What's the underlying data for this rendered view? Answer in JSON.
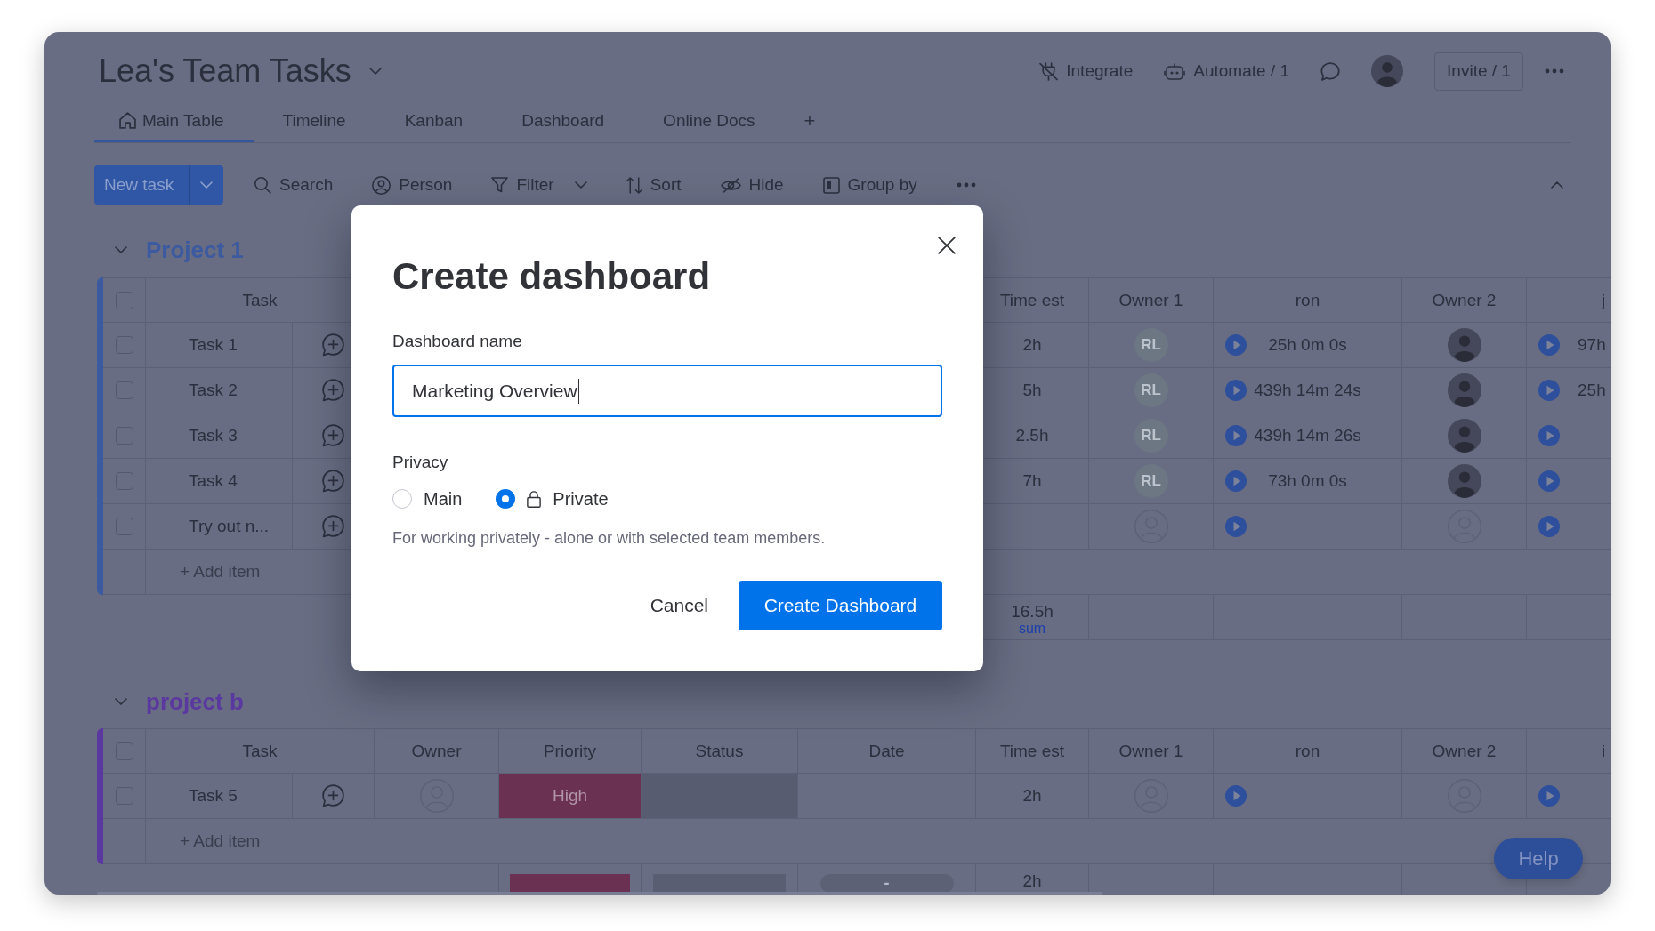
{
  "board": {
    "title": "Lea's Team Tasks"
  },
  "header_actions": [
    {
      "kind": "integrate",
      "label": "Integrate"
    },
    {
      "kind": "automate",
      "label": "Automate / 1"
    },
    {
      "kind": "updates"
    },
    {
      "kind": "account"
    },
    {
      "kind": "invite",
      "label": "Invite / 1"
    },
    {
      "kind": "more"
    }
  ],
  "views": [
    {
      "kind": "main",
      "label": "Main Table",
      "selected": true
    },
    {
      "kind": "view",
      "label": "Timeline",
      "selected": false
    },
    {
      "kind": "view",
      "label": "Kanban",
      "selected": false
    },
    {
      "kind": "view",
      "label": "Dashboard",
      "selected": false
    },
    {
      "kind": "view",
      "label": "Online Docs",
      "selected": false
    }
  ],
  "add_view": "+",
  "toolbar": {
    "new_task": "New task",
    "items": [
      {
        "kind": "search",
        "label": "Search"
      },
      {
        "kind": "person",
        "label": "Person"
      },
      {
        "kind": "filter",
        "label": "Filter",
        "dropdown": true
      },
      {
        "kind": "sort",
        "label": "Sort"
      },
      {
        "kind": "hide",
        "label": "Hide"
      },
      {
        "kind": "group",
        "label": "Group by"
      },
      {
        "kind": "more"
      }
    ]
  },
  "groups": [
    {
      "title": "Project 1",
      "color": "#3c5aa0",
      "expanded": true,
      "all_checked": false,
      "columns": {
        "task": "Task",
        "time_est": "Time est",
        "owner_1": "Owner 1",
        "ron": "ron",
        "owner_2": "Owner 2",
        "column_10": "j"
      },
      "rows": [
        {
          "task": "Task 1",
          "checked": false,
          "time_est": "2h",
          "owner_1": {
            "kind": "initials",
            "initials": "RL"
          },
          "ron": "25h 0m 0s",
          "owner_2": {
            "kind": "photo"
          },
          "column_10": "97h"
        },
        {
          "task": "Task 2",
          "checked": false,
          "time_est": "5h",
          "owner_1": {
            "kind": "initials",
            "initials": "RL"
          },
          "ron": "439h 14m 24s",
          "owner_2": {
            "kind": "photo"
          },
          "column_10": "25h"
        },
        {
          "task": "Task 3",
          "checked": false,
          "time_est": "2.5h",
          "owner_1": {
            "kind": "initials",
            "initials": "RL"
          },
          "ron": "439h 14m 26s",
          "owner_2": {
            "kind": "photo"
          }
        },
        {
          "task": "Task 4",
          "checked": false,
          "time_est": "7h",
          "owner_1": {
            "kind": "initials",
            "initials": "RL"
          },
          "ron": "73h 0m 0s",
          "owner_2": {
            "kind": "photo"
          }
        },
        {
          "task": "Try out n...",
          "checked": false,
          "owner_1": {
            "kind": "empty"
          },
          "owner_2": {
            "kind": "empty"
          }
        }
      ],
      "add_item": "+ Add item",
      "summary": {
        "time_est": "16.5h",
        "time_est_caption": "sum"
      }
    },
    {
      "title": "project b",
      "color": "#5a389f",
      "expanded": true,
      "all_checked": false,
      "columns": {
        "task": "Task",
        "owner": "Owner",
        "priority": "Priority",
        "status": "Status",
        "date": "Date",
        "time_est": "Time est",
        "owner_1": "Owner 1",
        "ron": "ron",
        "owner_2": "Owner 2",
        "column_10": "i"
      },
      "rows": [
        {
          "task": "Task 5",
          "checked": false,
          "owner": {
            "kind": "empty"
          },
          "priority": {
            "label": "High",
            "color": "#6b3152"
          },
          "status": {
            "color": "#585c70"
          },
          "time_est": "2h",
          "owner_1": {
            "kind": "empty"
          },
          "owner_2": {
            "kind": "empty"
          }
        }
      ],
      "add_item": "+ Add item",
      "summary": {
        "priority": [
          {
            "color": "#6b3152"
          }
        ],
        "status": [
          {
            "color": "#5a5e72"
          }
        ],
        "date": "-",
        "time_est": "2h"
      }
    }
  ],
  "help": "Help",
  "dialog": {
    "title": "Create dashboard",
    "name_label": "Dashboard name",
    "name_value": "Marketing Overview",
    "privacy_label": "Privacy",
    "privacy_options": [
      {
        "kind": "plain",
        "label": "Main",
        "selected": false
      },
      {
        "kind": "locked",
        "label": "Private",
        "selected": true
      }
    ],
    "description": "For working privately - alone or with selected team members.",
    "cancel": "Cancel",
    "confirm": "Create Dashboard"
  }
}
